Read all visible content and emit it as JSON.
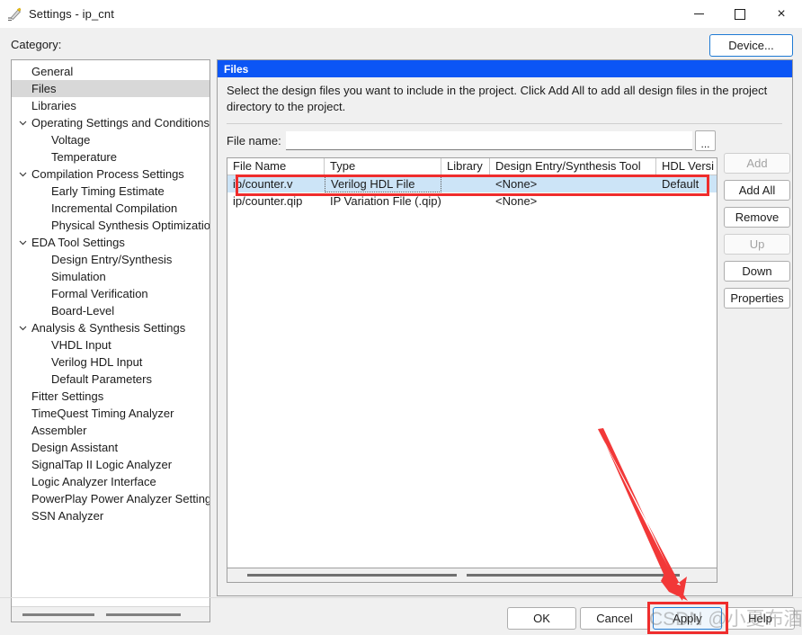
{
  "window": {
    "title": "Settings - ip_cnt",
    "icon": "settings-pencil-icon",
    "minimize_label": "",
    "maximize_label": "",
    "close_label": "×"
  },
  "toolbar": {
    "category_label": "Category:",
    "device_button": "Device..."
  },
  "sidebar": {
    "items": [
      {
        "label": "General",
        "indent": 1,
        "chevron": false,
        "selected": false
      },
      {
        "label": "Files",
        "indent": 1,
        "chevron": false,
        "selected": true
      },
      {
        "label": "Libraries",
        "indent": 1,
        "chevron": false,
        "selected": false
      },
      {
        "label": "Operating Settings and Conditions",
        "indent": 1,
        "chevron": true,
        "selected": false
      },
      {
        "label": "Voltage",
        "indent": 2,
        "chevron": false,
        "selected": false
      },
      {
        "label": "Temperature",
        "indent": 2,
        "chevron": false,
        "selected": false
      },
      {
        "label": "Compilation Process Settings",
        "indent": 1,
        "chevron": true,
        "selected": false
      },
      {
        "label": "Early Timing Estimate",
        "indent": 2,
        "chevron": false,
        "selected": false
      },
      {
        "label": "Incremental Compilation",
        "indent": 2,
        "chevron": false,
        "selected": false
      },
      {
        "label": "Physical Synthesis Optimization",
        "indent": 2,
        "chevron": false,
        "selected": false
      },
      {
        "label": "EDA Tool Settings",
        "indent": 1,
        "chevron": true,
        "selected": false
      },
      {
        "label": "Design Entry/Synthesis",
        "indent": 2,
        "chevron": false,
        "selected": false
      },
      {
        "label": "Simulation",
        "indent": 2,
        "chevron": false,
        "selected": false
      },
      {
        "label": "Formal Verification",
        "indent": 2,
        "chevron": false,
        "selected": false
      },
      {
        "label": "Board-Level",
        "indent": 2,
        "chevron": false,
        "selected": false
      },
      {
        "label": "Analysis & Synthesis Settings",
        "indent": 1,
        "chevron": true,
        "selected": false
      },
      {
        "label": "VHDL Input",
        "indent": 2,
        "chevron": false,
        "selected": false
      },
      {
        "label": "Verilog HDL Input",
        "indent": 2,
        "chevron": false,
        "selected": false
      },
      {
        "label": "Default Parameters",
        "indent": 2,
        "chevron": false,
        "selected": false
      },
      {
        "label": "Fitter Settings",
        "indent": 1,
        "chevron": false,
        "selected": false
      },
      {
        "label": "TimeQuest Timing Analyzer",
        "indent": 1,
        "chevron": false,
        "selected": false
      },
      {
        "label": "Assembler",
        "indent": 1,
        "chevron": false,
        "selected": false
      },
      {
        "label": "Design Assistant",
        "indent": 1,
        "chevron": false,
        "selected": false
      },
      {
        "label": "SignalTap II Logic Analyzer",
        "indent": 1,
        "chevron": false,
        "selected": false
      },
      {
        "label": "Logic Analyzer Interface",
        "indent": 1,
        "chevron": false,
        "selected": false
      },
      {
        "label": "PowerPlay Power Analyzer Settings",
        "indent": 1,
        "chevron": false,
        "selected": false
      },
      {
        "label": "SSN Analyzer",
        "indent": 1,
        "chevron": false,
        "selected": false
      }
    ]
  },
  "page": {
    "header": "Files",
    "description": "Select the design files you want to include in the project. Click Add All to add all design files in the project directory to the project.",
    "file_name_label": "File name:",
    "file_name_value": "",
    "file_name_placeholder": "",
    "browse_button": "...",
    "add_button": "Add",
    "side_buttons": [
      {
        "label": "Add",
        "disabled": true
      },
      {
        "label": "Add All",
        "disabled": false
      },
      {
        "label": "Remove",
        "disabled": false
      },
      {
        "label": "Up",
        "disabled": true
      },
      {
        "label": "Down",
        "disabled": false
      },
      {
        "label": "Properties",
        "disabled": false
      }
    ],
    "table": {
      "columns": [
        "File Name",
        "Type",
        "Library",
        "Design Entry/Synthesis Tool",
        "HDL Versi"
      ],
      "rows": [
        {
          "cells": [
            "ip/counter.v",
            "Verilog HDL File",
            "",
            "<None>",
            "Default"
          ],
          "selected": true,
          "focused_cell": 1
        },
        {
          "cells": [
            "ip/counter.qip",
            "IP Variation File (.qip)",
            "",
            "<None>",
            ""
          ],
          "selected": false,
          "focused_cell": -1
        }
      ]
    }
  },
  "footer": {
    "ok": "OK",
    "cancel": "Cancel",
    "apply": "Apply",
    "help": "Help"
  },
  "annotations": {
    "watermark": "CSDN @小夏布酒",
    "highlight_color": "#ef2d2d",
    "arrow_color": "#f23838"
  }
}
